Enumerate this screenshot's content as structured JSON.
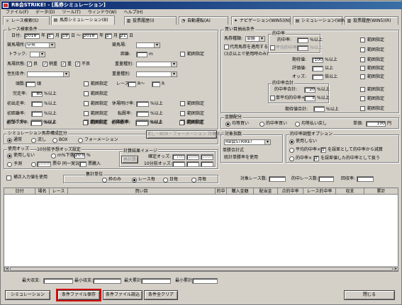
{
  "window": {
    "title": "RB会STRIKE! - [馬券シミュレーション]"
  },
  "menu": [
    "ファイル(F)",
    "データ(D)",
    "ツール(T)",
    "ウィンドウ(W)",
    "ヘルプ(H)"
  ],
  "tabs": [
    "レース検索(S)",
    "馬券シミュレーション(B)",
    "投票履歴(I)",
    "自動運転(A)",
    "ナビゲーション(WIN5)(N)",
    "シミュレーション(WIN5)(M)",
    "投票履歴(WIN5)(R)"
  ],
  "race": {
    "legend": "レース検索条件",
    "date_label": "日付:",
    "date_from": {
      "year": "2018",
      "y": "年",
      "month": "1",
      "m": "月",
      "day": "19",
      "d": "日"
    },
    "tilde": "～",
    "date_to": {
      "year": "2018",
      "month": "1",
      "day": "21"
    },
    "venue_label": "競馬場所:",
    "venue": "中央",
    "track_label": "トラック:",
    "track": "",
    "dist_label": "距離:",
    "dist_unit": "m",
    "range_label": "範囲指定",
    "course_label": "競馬場:",
    "baba_label": "馬場状態:",
    "baba": [
      "良",
      "稍重",
      "重",
      "不良"
    ],
    "class_label": "重量種別:",
    "sex_label": "性別条件:",
    "heads_label": "頭数:",
    "heads_unit": "頭",
    "race_label": "レース:",
    "race_unit": "R",
    "race_tilde": "R～",
    "finish_label": "完走率:",
    "finish_val": "80",
    "finish_unit": "%以上",
    "rows": [
      [
        "初出走率:",
        "休場明け率:"
      ],
      [
        "初距離率:",
        "転厩率:"
      ],
      [
        "初騎手率:",
        "初調教率:"
      ],
      [
        "初コース率:",
        "初昇級率:"
      ]
    ],
    "ijo": "%以上",
    "within": "範囲指定"
  },
  "buy": {
    "legend": "買い目抽出条件",
    "shiki_label": "馬券種類:",
    "shiki": "単勝",
    "proxy": "代用馬券を適用する",
    "proxy_sub": "(3点以上で使用時のみ)",
    "group_hit": "的中率",
    "hit_label": "的中率:",
    "hit_unit": "%以上",
    "avg_hit": "平均的中率+",
    "avg_unit": "%以上",
    "period_label": "期待値:",
    "period_val": "100",
    "period_unit": "%以上",
    "eval_label": "評価値:",
    "eval_unit": "以上",
    "odds_label": "オッズ:",
    "odds_unit": "倍以上",
    "group_comb": "的中率合計",
    "comb_hit": "的中率合計:",
    "comb_val": "20",
    "comb_unit": "%以上",
    "comb_avg": "単平均的中率+",
    "comb_avg_val": "5",
    "comb_avg_unit": "%以上",
    "period_sum": "期待値合計:",
    "period_sum_unit": "%以上",
    "range": "範囲指定"
  },
  "amount": {
    "legend": "金額配分",
    "opts": [
      "均等買い",
      "的中率買い",
      "均等払い戻し"
    ],
    "unit_label": "単価:",
    "unit_val": "100",
    "yen": "円"
  },
  "composition": {
    "legend": "シミュレーション馬券構成区分",
    "opts": [
      "通常",
      "流し",
      "BOX",
      "フォーメーション"
    ],
    "btn": "流し・BOX・フォーメーション 対象馬の設定"
  },
  "odds": {
    "legend": "使用オッズ",
    "opt1": "使用しない",
    "opt2": "予測",
    "pct_label": "m%下落",
    "pct_val": "20.0",
    "pct_unit": "%",
    "near_val": "10000",
    "near_label": "票中",
    "near2": "同一実況",
    "near3": "票騰入",
    "minus": "-10分前予想オッズ設定",
    "img_legend": "計算結果イメージ",
    "img_a": "確定オッズ:",
    "img_b": "10分前オッズ:",
    "img_vals": [
      "100",
      "1000",
      "1000"
    ],
    "calc_btn": "再計算"
  },
  "target": {
    "legend": "対象指数",
    "val": "RB会STRIKE!",
    "sub": "単勝合計式",
    "sub2": "統計単勝率を使用"
  },
  "hitopt": {
    "legend": "的中率調整オプション",
    "o1": "使用しない",
    "o2": "平均的中率×",
    "o2b": "を誤差として的中率から減算",
    "o3": "的中率×",
    "o3b": "を誤差値した的中率として扱う",
    "v1": "1",
    "v2": "1"
  },
  "unit": {
    "legend": "集計単位",
    "opts": [
      "枠のみ",
      "レース毎",
      "日毎",
      "月毎"
    ]
  },
  "misc": {
    "correct": "補正入力値を使用",
    "race_count": "対象レース数:",
    "hit_count": "的中レース数:",
    "recov": "回収率:"
  },
  "grid": {
    "cols": [
      "日付",
      "場名",
      "レース",
      "買い目",
      "的中",
      "購入金額",
      "配当金",
      "点的中率",
      "レース的中率",
      "収支",
      "累計"
    ]
  },
  "summary": [
    "最大収支:",
    "最小収支:",
    "最大累計:",
    "最小累計:"
  ],
  "buttons": {
    "sim": "シミュレーション",
    "save": "条件ファイル保存",
    "load": "条件ファイル読込",
    "clear": "条件全クリア",
    "close": "閉じる"
  }
}
